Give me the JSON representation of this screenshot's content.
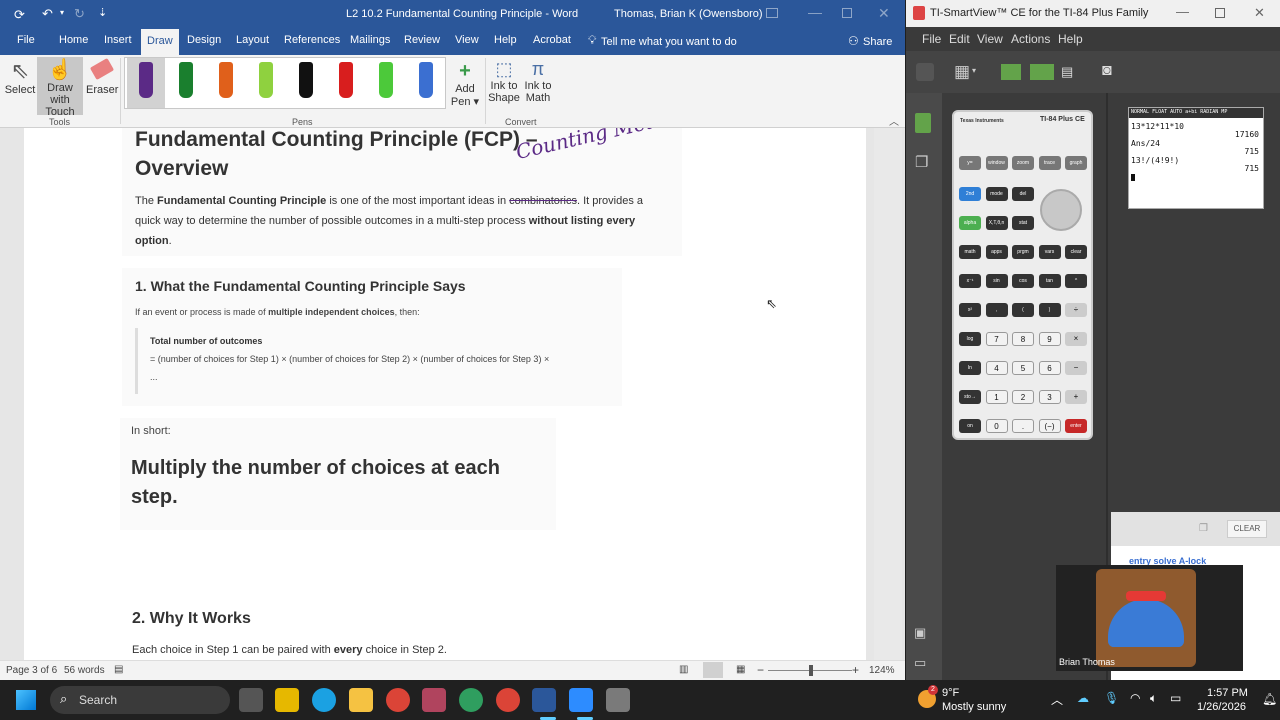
{
  "word": {
    "window_title": "L2 10.2 Fundamental Counting Principle  -  Word",
    "user": "Thomas, Brian K (Owensboro)",
    "tabs": [
      "File",
      "Home",
      "Insert",
      "Draw",
      "Design",
      "Layout",
      "References",
      "Mailings",
      "Review",
      "View",
      "Help",
      "Acrobat"
    ],
    "tell_me": "Tell me what you want to do",
    "share": "Share",
    "tools": {
      "select": "Select",
      "draw_touch_1": "Draw with",
      "draw_touch_2": "Touch",
      "eraser": "Eraser",
      "group": "Tools"
    },
    "pens_group": "Pens",
    "add_pen_1": "Add",
    "add_pen_2": "Pen",
    "ink_shape_1": "Ink to",
    "ink_shape_2": "Shape",
    "ink_math_1": "Ink to",
    "ink_math_2": "Math",
    "convert_group": "Convert",
    "pen_colors": [
      "#5b2a86",
      "#1a7f2e",
      "#e0601b",
      "#8fd13f",
      "#111111",
      "#d81e1e",
      "#4cc93a",
      "#3b6fd1"
    ],
    "doc": {
      "title_line1": "Fundamental Counting Principle (FCP) –",
      "title_line2": "Overview",
      "ink_annotation": "Counting Methods",
      "intro_1": "The ",
      "intro_bold1": "Fundamental Counting Principle",
      "intro_2": " is one of the most important ideas in ",
      "intro_strike": "combinatorics",
      "intro_3": ". It provides a",
      "intro_line2a": "quick way to determine the number of possible outcomes in a multi-step process ",
      "intro_bold2": "without listing every",
      "intro_bold3": "option",
      "intro_end": ".",
      "sec1_heading": "1. What the Fundamental Counting Principle Says",
      "sec1_text_a": "If an event or process is made of ",
      "sec1_text_bold": "multiple independent choices",
      "sec1_text_b": ", then:",
      "quote_title": "Total number of outcomes",
      "quote_line": "= (number of choices for Step 1) × (number of choices for Step 2) × (number of choices for Step 3) ×",
      "quote_dots": "...",
      "in_short": "In short:",
      "big_1": "Multiply the number of choices at each",
      "big_2": "step.",
      "sec2_heading": "2. Why It Works",
      "sec2_text_a": "Each choice in Step 1 can be paired with ",
      "sec2_text_bold": "every",
      "sec2_text_b": " choice in Step 2."
    },
    "status": {
      "page": "Page 3 of 6",
      "words": "56 words",
      "zoom": "124%"
    }
  },
  "ti": {
    "window_title": "TI-SmartView™ CE for the TI-84 Plus Family",
    "menu": [
      "File",
      "Edit",
      "View",
      "Actions",
      "Help"
    ],
    "brand": "Texas Instruments",
    "model": "TI-84 Plus CE",
    "screen_header": "NORMAL FLOAT AUTO a+bi RADIAN MP",
    "history": [
      {
        "expr": "13*12*11*10",
        "result": "17160"
      },
      {
        "expr": "Ans/24",
        "result": "715"
      },
      {
        "expr": "13!/(4!9!)",
        "result": "715"
      }
    ],
    "clear": "CLEAR",
    "keys_row1": [
      "y=",
      "window",
      "zoom",
      "trace",
      "graph"
    ],
    "keys_row2": [
      "2nd",
      "mode",
      "del"
    ],
    "keys_row3": [
      "alpha",
      "X,T,θ,n",
      "stat"
    ],
    "keys_row4": [
      "math",
      "apps",
      "prgm",
      "vars",
      "clear"
    ],
    "keys_row5": [
      "x⁻¹",
      "sin",
      "cos",
      "tan",
      "^"
    ],
    "keys_row6": [
      "x²",
      ",",
      "(",
      ")",
      "÷"
    ],
    "keys_row7": [
      "log",
      "7",
      "8",
      "9",
      "×"
    ],
    "keys_row8": [
      "ln",
      "4",
      "5",
      "6",
      "−"
    ],
    "keys_row9": [
      "sto→",
      "1",
      "2",
      "3",
      "+"
    ],
    "keys_row10": [
      "on",
      "0",
      ".",
      "(−)",
      "enter"
    ],
    "webcam_name": "Brian Thomas",
    "overlay_text": "entry solve  A-lock"
  },
  "taskbar": {
    "search": "Search",
    "weather_temp": "9°F",
    "weather_desc": "Mostly sunny",
    "weather_badge": "2",
    "time": "1:57 PM",
    "date": "1/26/2026"
  }
}
